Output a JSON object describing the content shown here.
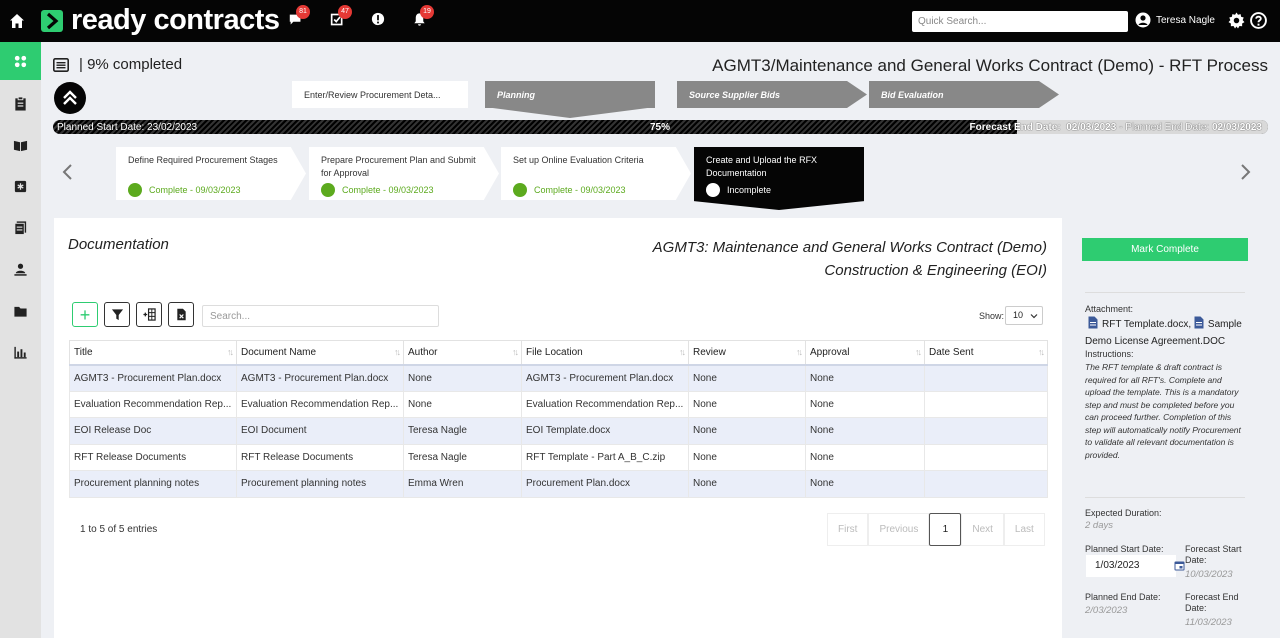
{
  "header": {
    "logo_text": "ready contracts",
    "badges": {
      "messages": "81",
      "tasks": "47",
      "notifications": "19"
    },
    "search_placeholder": "Quick Search...",
    "user_name": "Teresa Nagle"
  },
  "process": {
    "percent_label": "| 9% completed",
    "title": "AGMT3/Maintenance and General Works Contract (Demo) - RFT Process",
    "stages": [
      {
        "label": "Enter/Review Procurement Deta..."
      },
      {
        "label": "Planning"
      },
      {
        "label": "Source Supplier Bids"
      },
      {
        "label": "Bid Evaluation"
      }
    ],
    "progress": {
      "percent_value": 75,
      "planned_start": "Planned Start Date: 23/02/2023",
      "percent_label": "75%",
      "forecast_end_label": "Forecast End Date:",
      "forecast_end_value": "02/03/2023",
      "planned_end_label": "- Planned End Date:",
      "planned_end_value": "02/03/2023"
    },
    "steps": [
      {
        "title": "Define Required Procurement Stages",
        "status": "Complete - 09/03/2023"
      },
      {
        "title": "Prepare Procurement Plan and Submit for Approval",
        "status": "Complete - 09/03/2023"
      },
      {
        "title": "Set up Online Evaluation Criteria",
        "status": "Complete - 09/03/2023"
      },
      {
        "title": "Create and Upload the RFX Documentation",
        "status": "Incomplete"
      }
    ]
  },
  "documentation": {
    "section_title": "Documentation",
    "contract_title": "AGMT3: Maintenance and General Works Contract (Demo)",
    "category": "Construction & Engineering (EOI)",
    "search_placeholder": "Search...",
    "show_label": "Show:",
    "show_value": "10",
    "columns": [
      "Title",
      "Document Name",
      "Author",
      "File Location",
      "Review",
      "Approval",
      "Date Sent"
    ],
    "rows": [
      [
        "AGMT3 - Procurement Plan.docx",
        "AGMT3 - Procurement Plan.docx",
        "None",
        "AGMT3 - Procurement Plan.docx",
        "None",
        "None",
        ""
      ],
      [
        "Evaluation Recommendation Rep...",
        "Evaluation Recommendation Rep...",
        "None",
        "Evaluation Recommendation Rep...",
        "None",
        "None",
        ""
      ],
      [
        "EOI Release Doc",
        "EOI Document",
        "Teresa Nagle",
        "EOI Template.docx",
        "None",
        "None",
        ""
      ],
      [
        "RFT Release Documents",
        "RFT Release Documents",
        "Teresa Nagle",
        "RFT Template - Part A_B_C.zip",
        "None",
        "None",
        ""
      ],
      [
        "Procurement planning notes",
        "Procurement planning notes",
        "Emma Wren",
        "Procurement Plan.docx",
        "None",
        "None",
        ""
      ]
    ],
    "entries_text": "1 to 5 of 5 entries",
    "pager": {
      "first": "First",
      "previous": "Previous",
      "current": "1",
      "next": "Next",
      "last": "Last"
    }
  },
  "panel": {
    "mark_complete": "Mark Complete",
    "attachment_label": "Attachment:",
    "attachment_1": "RFT Template.docx,",
    "attachment_2_a": "Sample",
    "attachment_2_b": "Demo License Agreement.DOC",
    "instructions_label": "Instructions:",
    "instructions": "The RFT template & draft contract is required for all RFT's. Complete and upload the template. This is a mandatory step and must be completed before you can proceed further. Completion of this step will automatically notify Procurement to validate all relevant documentation is provided.",
    "expected_duration_label": "Expected Duration:",
    "expected_duration": "2 days",
    "planned_start_label": "Planned Start Date:",
    "planned_start": "1/03/2023",
    "forecast_start_label": "Forecast Start Date:",
    "forecast_start": "10/03/2023",
    "planned_end_label": "Planned End Date:",
    "planned_end": "2/03/2023",
    "forecast_end_label": "Forecast End Date:",
    "forecast_end": "11/03/2023"
  },
  "colors": {
    "brand_green": "#2ecc71",
    "complete_green": "#5caa1e",
    "badge_red": "#e53935",
    "row_stripe": "#eaeef9"
  }
}
